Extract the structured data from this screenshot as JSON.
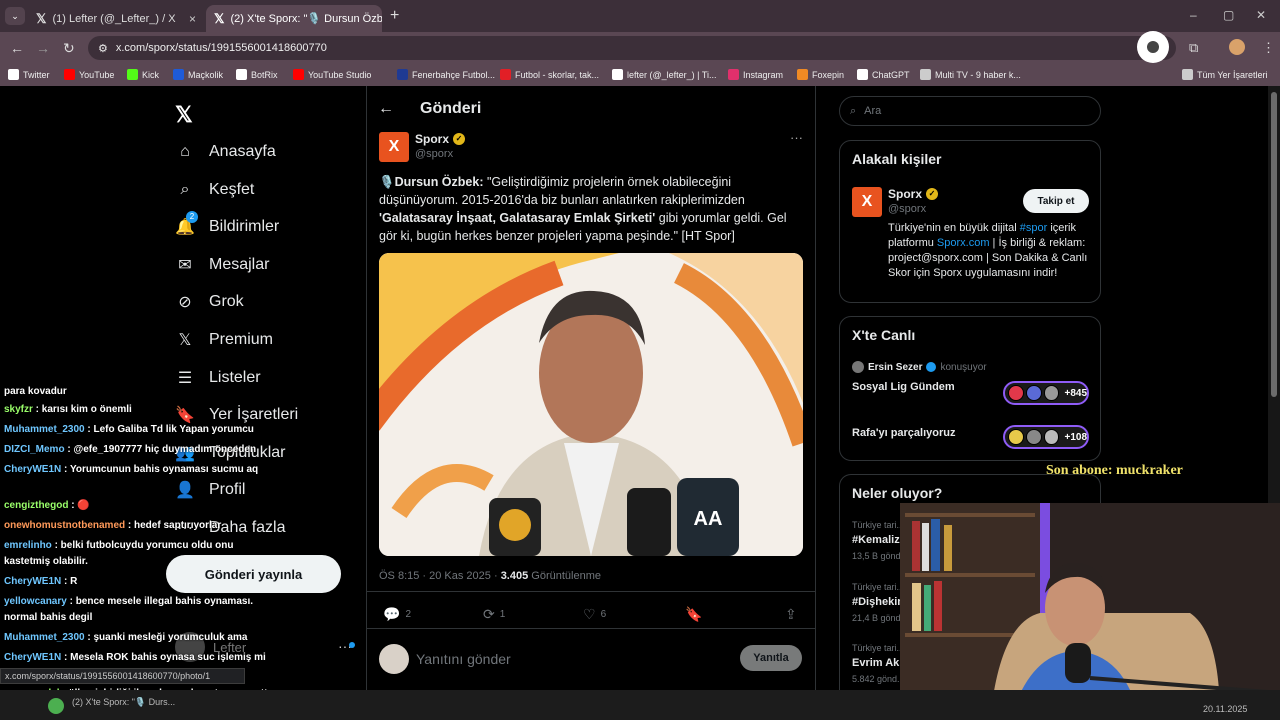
{
  "browser": {
    "tabs": [
      {
        "label": "(1) Lefter (@_Lefter_) / X",
        "close": "×"
      },
      {
        "label": "(2) X'te Sporx: \"🎙️ Dursun Özb...",
        "close": "×"
      }
    ],
    "new_tab": "+",
    "url": "x.com/sporx/status/1991556001418600770",
    "window_controls": [
      "–",
      "▢",
      "✕"
    ],
    "bookmarks": [
      {
        "label": "Twitter",
        "icon": "x-icon",
        "color": "#ffffff"
      },
      {
        "label": "YouTube",
        "icon": "youtube-icon",
        "color": "#ff0000"
      },
      {
        "label": "Kick",
        "icon": "kick-icon",
        "color": "#53fc18"
      },
      {
        "label": "Maçkolik",
        "icon": "mackolik-icon",
        "color": "#1e5bd8"
      },
      {
        "label": "BotRix",
        "icon": "botrix-icon",
        "color": "#ffffff"
      },
      {
        "label": "YouTube Studio",
        "icon": "youtube-studio-icon",
        "color": "#ff0000"
      },
      {
        "label": "Fenerbahçe Futbol...",
        "icon": "fenerbahce-icon",
        "color": "#1f3a93"
      },
      {
        "label": "Futbol - skorlar, tak...",
        "icon": "flashscore-icon",
        "color": "#e21f26"
      },
      {
        "label": "lefter (@_lefter_) | Ti...",
        "icon": "tiktok-icon",
        "color": "#ffffff"
      },
      {
        "label": "Instagram",
        "icon": "instagram-icon",
        "color": "#e1306c"
      },
      {
        "label": "Foxepin",
        "icon": "foxepin-icon",
        "color": "#f08a24"
      },
      {
        "label": "ChatGPT",
        "icon": "chatgpt-icon",
        "color": "#ffffff"
      },
      {
        "label": "Multi TV - 9 haber k...",
        "icon": "tv-icon",
        "color": "#cccccc"
      },
      {
        "label": "Tüm Yer İşaretleri",
        "icon": "folder-icon",
        "color": "#cccccc"
      }
    ]
  },
  "sidebar": {
    "items": [
      {
        "label": "Anasayfa",
        "icon": "home-icon"
      },
      {
        "label": "Keşfet",
        "icon": "search-icon"
      },
      {
        "label": "Bildirimler",
        "icon": "bell-icon",
        "badge": "2"
      },
      {
        "label": "Mesajlar",
        "icon": "mail-icon"
      },
      {
        "label": "Grok",
        "icon": "grok-icon"
      },
      {
        "label": "Premium",
        "icon": "x-premium-icon"
      },
      {
        "label": "Listeler",
        "icon": "list-icon"
      },
      {
        "label": "Yer İşaretleri",
        "icon": "bookmark-icon"
      },
      {
        "label": "Topluluklar",
        "icon": "communities-icon"
      },
      {
        "label": "Profil",
        "icon": "profile-icon"
      },
      {
        "label": "Daha fazla",
        "icon": "more-icon"
      }
    ],
    "post_button": "Gönderi yayınla",
    "account_name": "Lefter",
    "account_more": "···"
  },
  "post": {
    "header": "Gönderi",
    "author": "Sporx",
    "handle": "@sporx",
    "text_line1_bold": "Dursun Özbek:",
    "text_part1": " \"Geliştirdiğimiz projelerin örnek olabileceğini düşünüyorum. 2015-2016'da biz bunları anlatırken rakiplerimizden ",
    "text_bold2": "'Galatasaray İnşaat, Galatasaray Emlak Şirketi'",
    "text_part2": " gibi yorumlar geldi. Gel gör ki, bugün herkes benzer projeleri yapma peşinde.\"  [HT Spor]",
    "mic": "🎙️",
    "time": "ÖS 8:15 · 20 Kas 2025 · ",
    "views": "3.405",
    "views_label": " Görüntülenme",
    "actions": [
      {
        "icon": "reply-icon",
        "count": "2"
      },
      {
        "icon": "retweet-icon",
        "count": "1"
      },
      {
        "icon": "like-icon",
        "count": "6"
      },
      {
        "icon": "bookmark-icon",
        "count": ""
      },
      {
        "icon": "share-icon",
        "count": ""
      }
    ],
    "reply_placeholder": "Yanıtını gönder",
    "reply_button": "Yanıtla"
  },
  "right": {
    "search_placeholder": "Ara",
    "related_title": "Alakalı kişiler",
    "related_name": "Sporx",
    "related_handle": "@sporx",
    "follow_button": "Takip et",
    "bio_1": "Türkiye'nin en büyük dijital ",
    "bio_hashtag": "#spor",
    "bio_2": " içerik platformu ",
    "bio_link": "Sporx.com",
    "bio_3": " | İş birliği & reklam: project@sporx.com | Son Dakika & Canlı Skor için Sporx uygulamasını indir!",
    "live_title": "X'te Canlı",
    "live_host": "Ersin Sezer",
    "live_host_status": "konuşuyor",
    "spaces": [
      {
        "title": "Sosyal Lig Gündem",
        "count": "+845"
      },
      {
        "title": "Rafa'yı parçalıyoruz",
        "count": "+108"
      }
    ],
    "trends_title": "Neler oluyor?",
    "trends": [
      {
        "category": "Türkiye tari...",
        "name": "#Kemaliz...",
        "count": "13,5 B gönd..."
      },
      {
        "category": "Türkiye tari...",
        "name": "#Dişhekin...",
        "count": "21,4 B gönd..."
      },
      {
        "category": "Türkiye tari...",
        "name": "Evrim Akı...",
        "count": "5.842 gönd..."
      }
    ]
  },
  "overlay": {
    "chat": [
      {
        "user": "",
        "text": "para kovadur",
        "ucolor": "u"
      },
      {
        "user": "skyfzr",
        "text": " : karısı kim o önemli",
        "ucolor": "u3"
      },
      {
        "user": "Muhammet_2300",
        "text": " : Lefo Galiba Td lik Yapan yorumcu",
        "ucolor": "u"
      },
      {
        "user": "DIZCI_Memo",
        "text": " : @efe_1907777 hiç duymadım önceden",
        "ucolor": "u"
      },
      {
        "user": "CheryWE1N",
        "text": " : Yorumcunun bahis oynaması sucmu aq",
        "ucolor": "u"
      },
      {
        "user": "cengizthegod",
        "text": " : 🔴",
        "ucolor": "u3"
      },
      {
        "user": "onewhomustnotbenamed",
        "text": " : hedef saptırıyorlar",
        "ucolor": "u2"
      },
      {
        "user": "emrelinho",
        "text": " : belki futbolcuydu yorumcu oldu onu kastetmiş olabilir.",
        "ucolor": "u"
      },
      {
        "user": "CheryWE1N",
        "text": " : R",
        "ucolor": "u"
      },
      {
        "user": "yellowcanary",
        "text": " : bence mesele illegal bahis oynaması. normal bahis degil",
        "ucolor": "u"
      },
      {
        "user": "Muhammet_2300",
        "text": " : şuanki mesleği yorumculuk ama",
        "ucolor": "u"
      },
      {
        "user": "CheryWE1N",
        "text": " : Mesela ROK bahis oynasa suc işlemiş mi oluyo",
        "ucolor": "u"
      },
      {
        "user": "emresandal",
        "text": " : ülker işbirliği ile çok arsa konut yapıp sattı aziz",
        "ucolor": "u3"
      }
    ],
    "sub_alert": "Son abone: muckraker",
    "status_url": "x.com/sporx/status/1991556001418600770/photo/1",
    "taskbar_title": "(2) X'te Sporx: \"🎙️ Durs...",
    "taskbar_date": "20.11.2025"
  },
  "colors": {
    "accent": "#1d9bf0",
    "brand_sporx": "#e8531f",
    "verified": "#e2b719"
  }
}
